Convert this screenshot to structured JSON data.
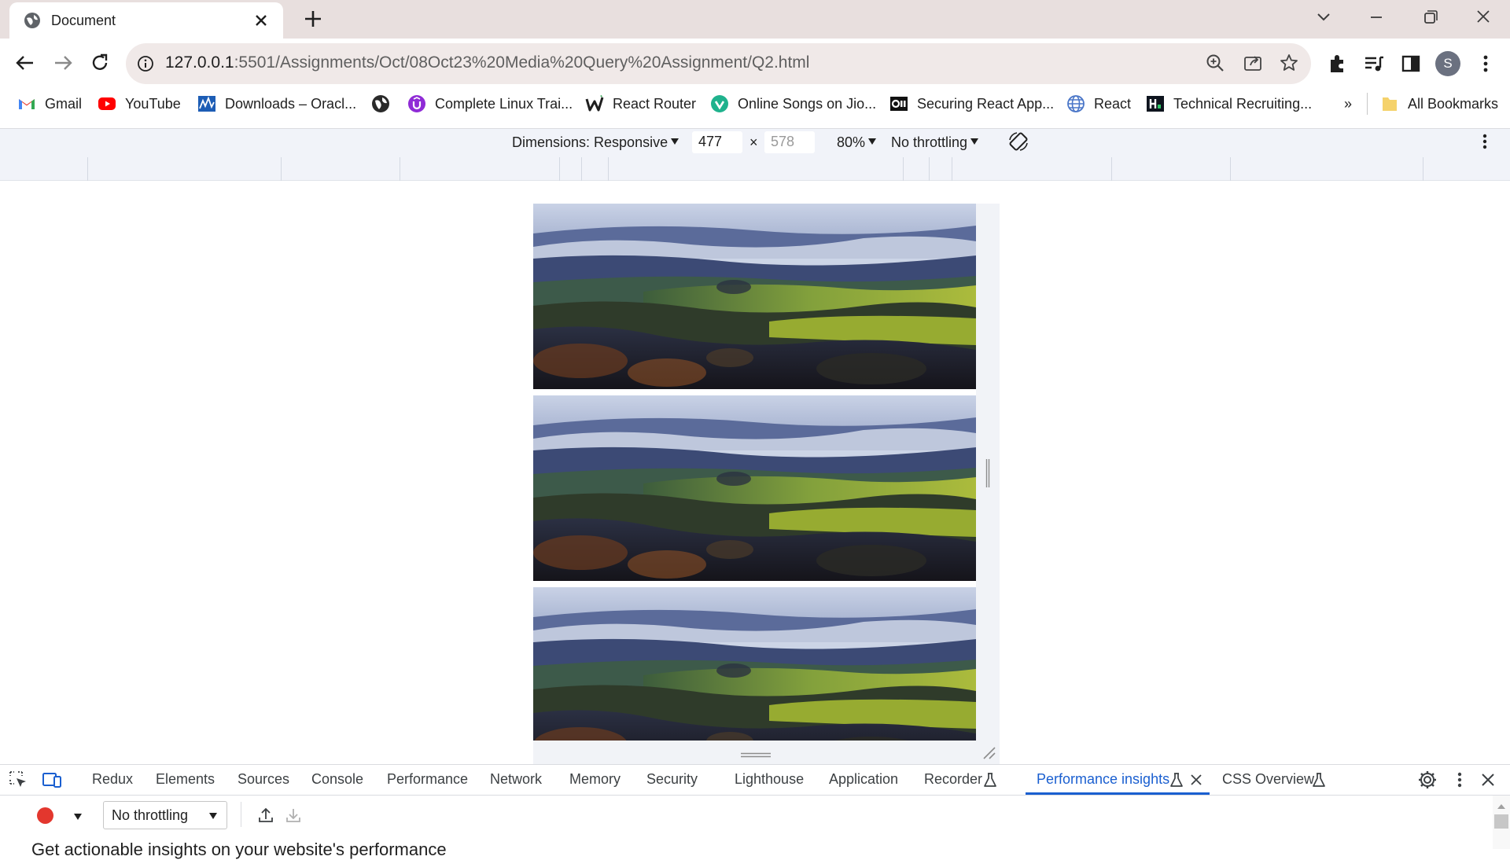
{
  "window": {
    "tab_title": "Document",
    "new_tab_label": "+"
  },
  "address_bar": {
    "url_host": "127.0.0.1",
    "url_path": ":5501/Assignments/Oct/08Oct23%20Media%20Query%20Assignment/Q2.html"
  },
  "profile": {
    "initial": "S"
  },
  "bookmarks": [
    {
      "label": "Gmail",
      "icon": "gmail-icon"
    },
    {
      "label": "YouTube",
      "icon": "youtube-icon"
    },
    {
      "label": "Downloads – Oracl...",
      "icon": "oracle-icon"
    },
    {
      "label": "",
      "icon": "globe-icon"
    },
    {
      "label": "Complete Linux Trai...",
      "icon": "udemy-icon"
    },
    {
      "label": "React Router",
      "icon": "w-icon"
    },
    {
      "label": "Online Songs on Jio...",
      "icon": "jiosaavn-icon"
    },
    {
      "label": "Securing React App...",
      "icon": "oauth-icon"
    },
    {
      "label": "React",
      "icon": "globe-icon"
    },
    {
      "label": "Technical Recruiting...",
      "icon": "hackerrank-icon"
    }
  ],
  "bookmarks_overflow": "»",
  "all_bookmarks": "All Bookmarks",
  "device_toolbar": {
    "dimensions_label": "Dimensions: Responsive",
    "width": "477",
    "separator": "×",
    "height": "578",
    "zoom": "80%",
    "throttling": "No throttling"
  },
  "devtools": {
    "tabs": [
      "Redux",
      "Elements",
      "Sources",
      "Console",
      "Performance",
      "Network",
      "Memory",
      "Security",
      "Lighthouse",
      "Application",
      "Recorder",
      "Performance insights",
      "CSS Overview"
    ],
    "active_tab": "Performance insights",
    "throttling_select": "No throttling",
    "cut_off_text": "Get actionable insights on your website's performance"
  },
  "colors": {
    "tab_strip": "#e8dfde",
    "omnibox": "#f0e9e8",
    "devtools_accent": "#1a5fd0",
    "record": "#e3372e"
  }
}
